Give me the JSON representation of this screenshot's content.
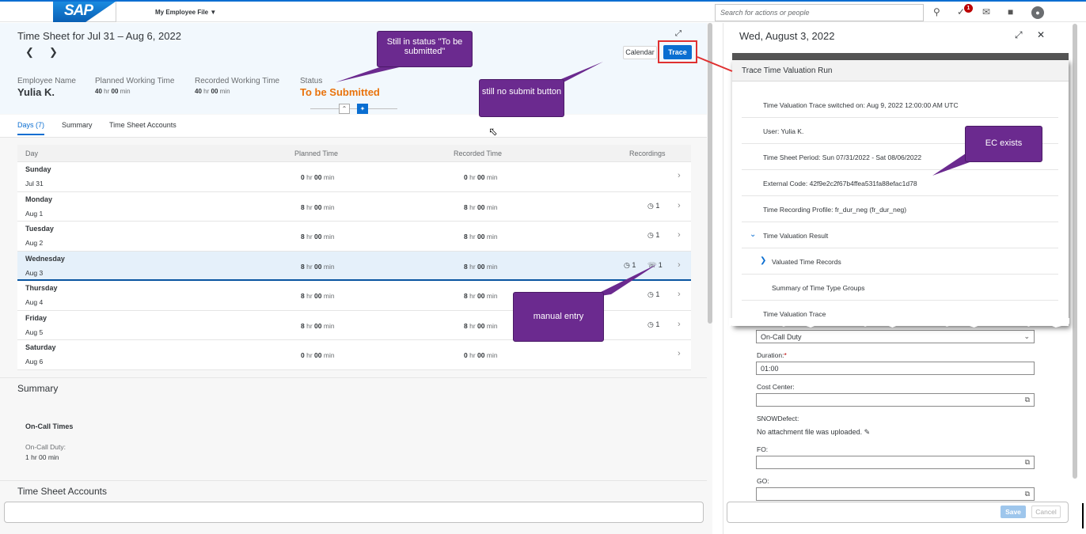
{
  "shell": {
    "logo": "SAP",
    "app_menu": "My Employee File",
    "search_placeholder": "Search for actions or people",
    "notification_count": "1"
  },
  "timesheet": {
    "title": "Time Sheet for Jul 31 – Aug 6, 2022",
    "calendar_button": "Calendar",
    "trace_button": "Trace",
    "employee_label": "Employee Name",
    "employee_name": "Yulia K.",
    "planned_label": "Planned Working Time",
    "planned_hr": "40",
    "planned_min": "00",
    "recorded_label": "Recorded Working Time",
    "recorded_hr": "40",
    "recorded_min": "00",
    "status_label": "Status",
    "status_value": "To be Submitted",
    "hr_unit": "hr",
    "min_unit": "min"
  },
  "tabs": [
    "Days (7)",
    "Summary",
    "Time Sheet Accounts"
  ],
  "table": {
    "headers": [
      "Day",
      "Planned Time",
      "Recorded Time",
      "Recordings"
    ],
    "rows": [
      {
        "day": "Sunday",
        "date": "Jul 31",
        "planned_hr": "0",
        "planned_min": "00",
        "recorded_hr": "0",
        "recorded_min": "00",
        "rec1": "",
        "rec2": ""
      },
      {
        "day": "Monday",
        "date": "Aug 1",
        "planned_hr": "8",
        "planned_min": "00",
        "recorded_hr": "8",
        "recorded_min": "00",
        "rec1": "1",
        "rec2": ""
      },
      {
        "day": "Tuesday",
        "date": "Aug 2",
        "planned_hr": "8",
        "planned_min": "00",
        "recorded_hr": "8",
        "recorded_min": "00",
        "rec1": "1",
        "rec2": ""
      },
      {
        "day": "Wednesday",
        "date": "Aug 3",
        "planned_hr": "8",
        "planned_min": "00",
        "recorded_hr": "8",
        "recorded_min": "00",
        "rec1": "1",
        "rec2": "1"
      },
      {
        "day": "Thursday",
        "date": "Aug 4",
        "planned_hr": "8",
        "planned_min": "00",
        "recorded_hr": "8",
        "recorded_min": "00",
        "rec1": "1",
        "rec2": ""
      },
      {
        "day": "Friday",
        "date": "Aug 5",
        "planned_hr": "8",
        "planned_min": "00",
        "recorded_hr": "8",
        "recorded_min": "00",
        "rec1": "1",
        "rec2": ""
      },
      {
        "day": "Saturday",
        "date": "Aug 6",
        "planned_hr": "0",
        "planned_min": "00",
        "recorded_hr": "0",
        "recorded_min": "00",
        "rec1": "",
        "rec2": ""
      }
    ]
  },
  "summary": {
    "title": "Summary",
    "oncall_heading": "On-Call Times",
    "oncall_label": "On-Call Duty:",
    "oncall_value": "1 hr 00 min"
  },
  "accounts": {
    "title": "Time Sheet Accounts"
  },
  "detail": {
    "title": "Wed, August 3, 2022",
    "type_value": "On-Call Duty",
    "duration_label": "Duration:",
    "duration_required": "*",
    "duration_value": "01:00",
    "cost_center_label": "Cost Center:",
    "snow_label": "SNOWDefect:",
    "attachment_text": "No attachment file was uploaded.",
    "fo_label": "FO:",
    "go_label": "GO:",
    "save_button": "Save",
    "cancel_button": "Cancel"
  },
  "trace_popup": {
    "title": "Trace Time Valuation Run",
    "switched_on": "Time Valuation Trace switched on: Aug 9, 2022 12:00:00 AM UTC",
    "user": "User: Yulia K.",
    "period": "Time Sheet Period: Sun 07/31/2022 - Sat 08/06/2022",
    "external_code": "External Code: 42f9e2c2f67b4ffea531fa88efac1d78",
    "profile": "Time Recording Profile: fr_dur_neg (fr_dur_neg)",
    "result": "Time Valuation Result",
    "valuated": "Valuated Time Records",
    "summary_groups": "Summary of Time Type Groups",
    "trace": "Time Valuation Trace"
  },
  "callouts": {
    "status": "Still in status \"To be submitted\"",
    "no_submit": "still no submit button",
    "manual": "manual entry",
    "ec": "EC exists"
  },
  "colors": {
    "brand_blue": "#0a6ed1",
    "status_orange": "#e9730c",
    "callout_purple": "#6b2a8f",
    "highlight_red": "#e03030"
  }
}
